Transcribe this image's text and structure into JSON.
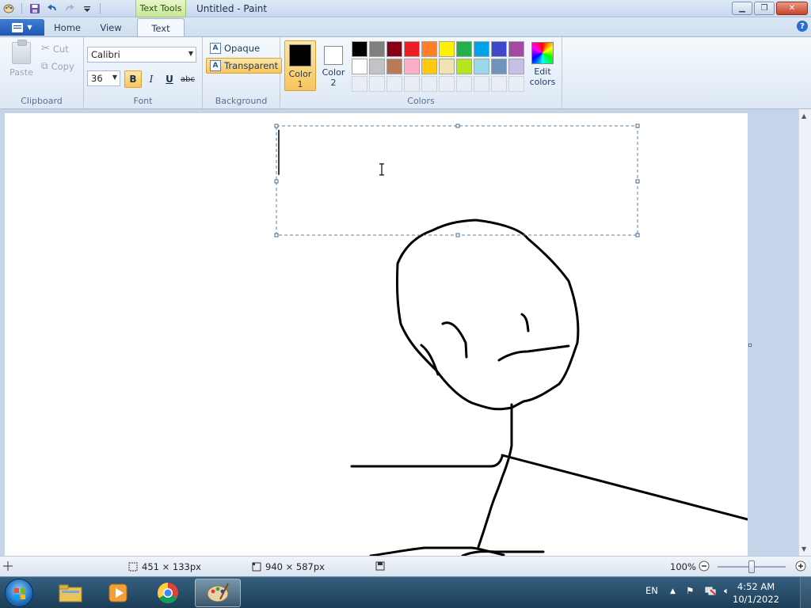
{
  "window": {
    "title": "Untitled - Paint",
    "context_tab": "Text Tools"
  },
  "tabs": {
    "home": "Home",
    "view": "View",
    "text": "Text"
  },
  "clipboard": {
    "paste": "Paste",
    "cut": "Cut",
    "copy": "Copy",
    "label": "Clipboard"
  },
  "font": {
    "family": "Calibri",
    "size": "36",
    "bold": "B",
    "italic": "I",
    "underline": "U",
    "strike": "abc",
    "label": "Font"
  },
  "background": {
    "opaque": "Opaque",
    "transparent": "Transparent",
    "label": "Background",
    "icon_letter": "A"
  },
  "colors": {
    "color1_label": "Color 1",
    "color2_label": "Color 2",
    "color1_value": "#000000",
    "color2_value": "#ffffff",
    "edit_label": "Edit colors",
    "label": "Colors",
    "palette_row1": [
      "#000000",
      "#7f7f7f",
      "#880015",
      "#ed1c24",
      "#ff7f27",
      "#fff200",
      "#22b14c",
      "#00a2e8",
      "#3f48cc",
      "#a349a4"
    ],
    "palette_row2": [
      "#ffffff",
      "#c3c3c3",
      "#b97a57",
      "#ffaec9",
      "#ffc90e",
      "#efe4b0",
      "#b5e61d",
      "#99d9ea",
      "#7092be",
      "#c8bfe7"
    ]
  },
  "status": {
    "selection_size": "451 × 133px",
    "canvas_size": "940 × 587px",
    "zoom": "100%"
  },
  "taskbar": {
    "lang": "EN",
    "time": "4:52 AM",
    "date": "10/1/2022"
  }
}
